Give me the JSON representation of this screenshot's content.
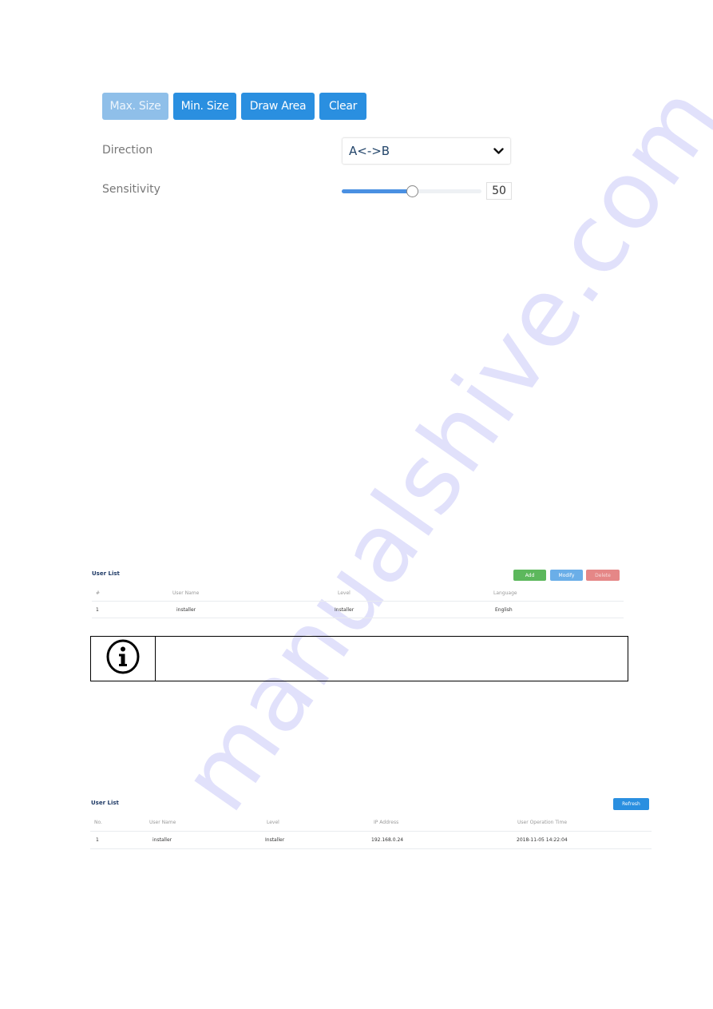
{
  "area_controls": {
    "buttons": [
      {
        "label": "Max. Size",
        "state": "disabled"
      },
      {
        "label": "Min. Size",
        "state": "active"
      },
      {
        "label": "Draw Area",
        "state": "active"
      },
      {
        "label": "Clear",
        "state": "active"
      }
    ],
    "direction": {
      "label": "Direction",
      "value": "A<->B"
    },
    "sensitivity": {
      "label": "Sensitivity",
      "value": "50",
      "percent": 50
    }
  },
  "watermark": "manualshive.com",
  "user_list_1": {
    "title": "User List",
    "buttons": {
      "add": "Add",
      "modify": "Modify",
      "delete": "Delete"
    },
    "columns": [
      "#",
      "User Name",
      "Level",
      "Language"
    ],
    "rows": [
      [
        "1",
        "installer",
        "Installer",
        "English"
      ]
    ]
  },
  "info_note": {
    "icon": "info-icon",
    "text": ""
  },
  "user_list_2": {
    "title": "User List",
    "buttons": {
      "refresh": "Refresh"
    },
    "columns": [
      "No.",
      "User Name",
      "Level",
      "IP Address",
      "User Operation Time"
    ],
    "rows": [
      [
        "1",
        "installer",
        "Installer",
        "192.168.0.24",
        "2018-11-05 14:22:04"
      ]
    ]
  },
  "colors": {
    "primary": "#2a8fe0",
    "disabled": "#8fbfe9",
    "add": "#5cb85c",
    "modify": "#6aaee8",
    "delete": "#e58787"
  }
}
